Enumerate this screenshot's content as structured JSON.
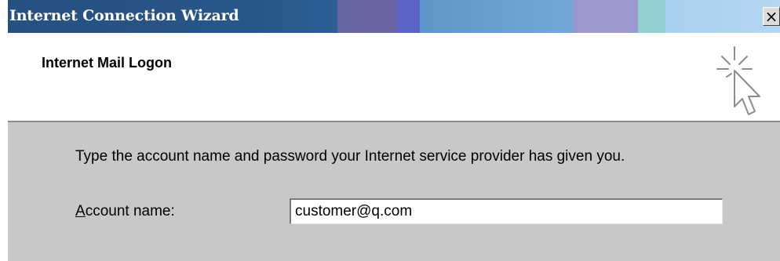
{
  "window": {
    "title": "Internet Connection Wizard",
    "close_label": "×"
  },
  "header": {
    "title": "Internet Mail Logon",
    "icon": "wizard-cursor-icon"
  },
  "body": {
    "instructions": "Type the account name and password your Internet service provider has given you.",
    "account_name": {
      "label_mnemonic": "A",
      "label_rest": "ccount name:",
      "value": "customer@q.com"
    }
  },
  "colors": {
    "titlebar_start": "#25507f",
    "content_bg": "#c8c8c8"
  }
}
